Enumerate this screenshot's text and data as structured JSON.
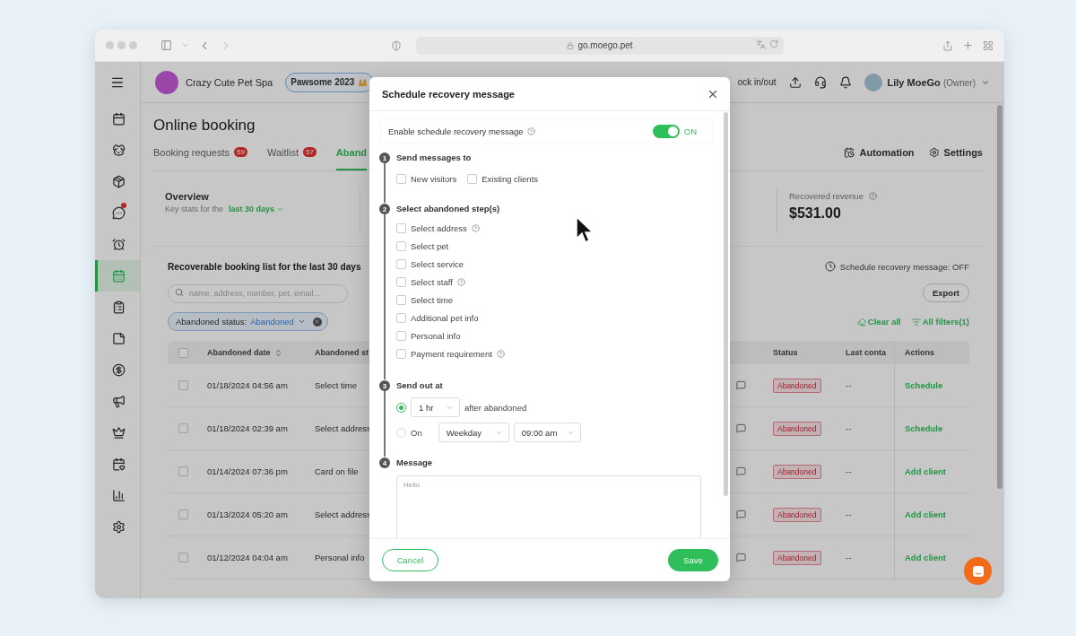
{
  "browser": {
    "url": "go.moego.pet"
  },
  "sidebar": {
    "items": [
      {
        "selected": false,
        "notification": false
      },
      {
        "selected": false,
        "notification": false
      },
      {
        "selected": false,
        "notification": false
      },
      {
        "selected": false,
        "notification": true
      },
      {
        "selected": false,
        "notification": false
      },
      {
        "selected": true,
        "notification": false
      },
      {
        "selected": false,
        "notification": false
      },
      {
        "selected": false,
        "notification": false
      },
      {
        "selected": false,
        "notification": false
      },
      {
        "selected": false,
        "notification": false
      },
      {
        "selected": false,
        "notification": false
      },
      {
        "selected": false,
        "notification": false
      },
      {
        "selected": false,
        "notification": false
      },
      {
        "selected": false,
        "notification": false
      }
    ]
  },
  "header": {
    "business": "Crazy Cute Pet Spa",
    "badge": "Pawsome 2023",
    "clock": "ock in/out",
    "user": "Lily MoeGo",
    "role": "(Owner)"
  },
  "page": {
    "title": "Online booking",
    "tabs": [
      {
        "label": "Booking requests",
        "count": "59",
        "selected": false
      },
      {
        "label": "Waitlist",
        "count": "57",
        "selected": false
      },
      {
        "label": "Aband",
        "selected": true
      }
    ],
    "actions": [
      "Automation",
      "Settings"
    ]
  },
  "overview": {
    "title": "Overview",
    "subtitle": "Key stats for the",
    "range": "last 30 days",
    "revenue_label": "Recovered revenue",
    "revenue": "$531.00"
  },
  "list": {
    "title": "Recoverable booking list for the last 30 days",
    "schedule_status": "Schedule recovery message: OFF",
    "search": {
      "placeholder": "name, address, number, pet, email..."
    },
    "export": "Export",
    "filter": {
      "label": "Abandoned status:",
      "value": "Abandoned"
    },
    "clear": "Clear all",
    "filters": "All filters(1)"
  },
  "table": {
    "columns": [
      "Abandoned date",
      "Abandoned st",
      "Status",
      "Last conta",
      "Actions"
    ],
    "select_all_checked": false,
    "rows": [
      {
        "checked": false,
        "date": "01/18/2024 04:56 am",
        "step": "Select time",
        "status": "Abandoned",
        "last_contact": "--",
        "action": "Schedule"
      },
      {
        "checked": false,
        "date": "01/18/2024 02:39 am",
        "step": "Select address",
        "status": "Abandoned",
        "last_contact": "--",
        "action": "Schedule"
      },
      {
        "checked": false,
        "date": "01/14/2024 07:36 pm",
        "step": "Card on file",
        "status": "Abandoned",
        "last_contact": "--",
        "action": "Add client"
      },
      {
        "checked": false,
        "date": "01/13/2024 05:20 am",
        "step": "Select address",
        "status": "Abandoned",
        "last_contact": "--",
        "action": "Add client"
      },
      {
        "checked": false,
        "date": "01/12/2024 04:04 am",
        "step": "Personal info",
        "status": "Abandoned",
        "last_contact": "--",
        "action": "Add client"
      }
    ]
  },
  "modal": {
    "title": "Schedule recovery message",
    "enable": {
      "label": "Enable schedule recovery message",
      "help": true,
      "on": true,
      "state_label": "ON"
    },
    "steps": [
      {
        "number": "1",
        "title": "Send messages to",
        "kind": "inline_checks",
        "options": [
          {
            "label": "New visitors",
            "checked": false,
            "help": false
          },
          {
            "label": "Existing clients",
            "checked": false,
            "help": false
          }
        ]
      },
      {
        "number": "2",
        "title": "Select abandoned step(s)",
        "kind": "checks",
        "options": [
          {
            "label": "Select address",
            "checked": false,
            "help": true
          },
          {
            "label": "Select pet",
            "checked": false,
            "help": false
          },
          {
            "label": "Select service",
            "checked": false,
            "help": false
          },
          {
            "label": "Select staff",
            "checked": false,
            "help": true
          },
          {
            "label": "Select time",
            "checked": false,
            "help": false
          },
          {
            "label": "Additional pet info",
            "checked": false,
            "help": false
          },
          {
            "label": "Personal info",
            "checked": false,
            "help": false
          },
          {
            "label": "Payment requirement",
            "checked": false,
            "help": true
          }
        ]
      },
      {
        "number": "3",
        "title": "Send out at",
        "kind": "timing",
        "options": [
          {
            "kind": "delay",
            "selected": true,
            "value": "1 hr",
            "suffix": "after abandoned"
          },
          {
            "kind": "scheduled",
            "selected": false,
            "label": "On",
            "day": "Weekday",
            "time": "09:00 am"
          }
        ]
      },
      {
        "number": "4",
        "title": "Message",
        "kind": "message",
        "placeholder": "Hello"
      }
    ],
    "buttons": {
      "cancel": "Cancel",
      "save": "Save"
    }
  }
}
